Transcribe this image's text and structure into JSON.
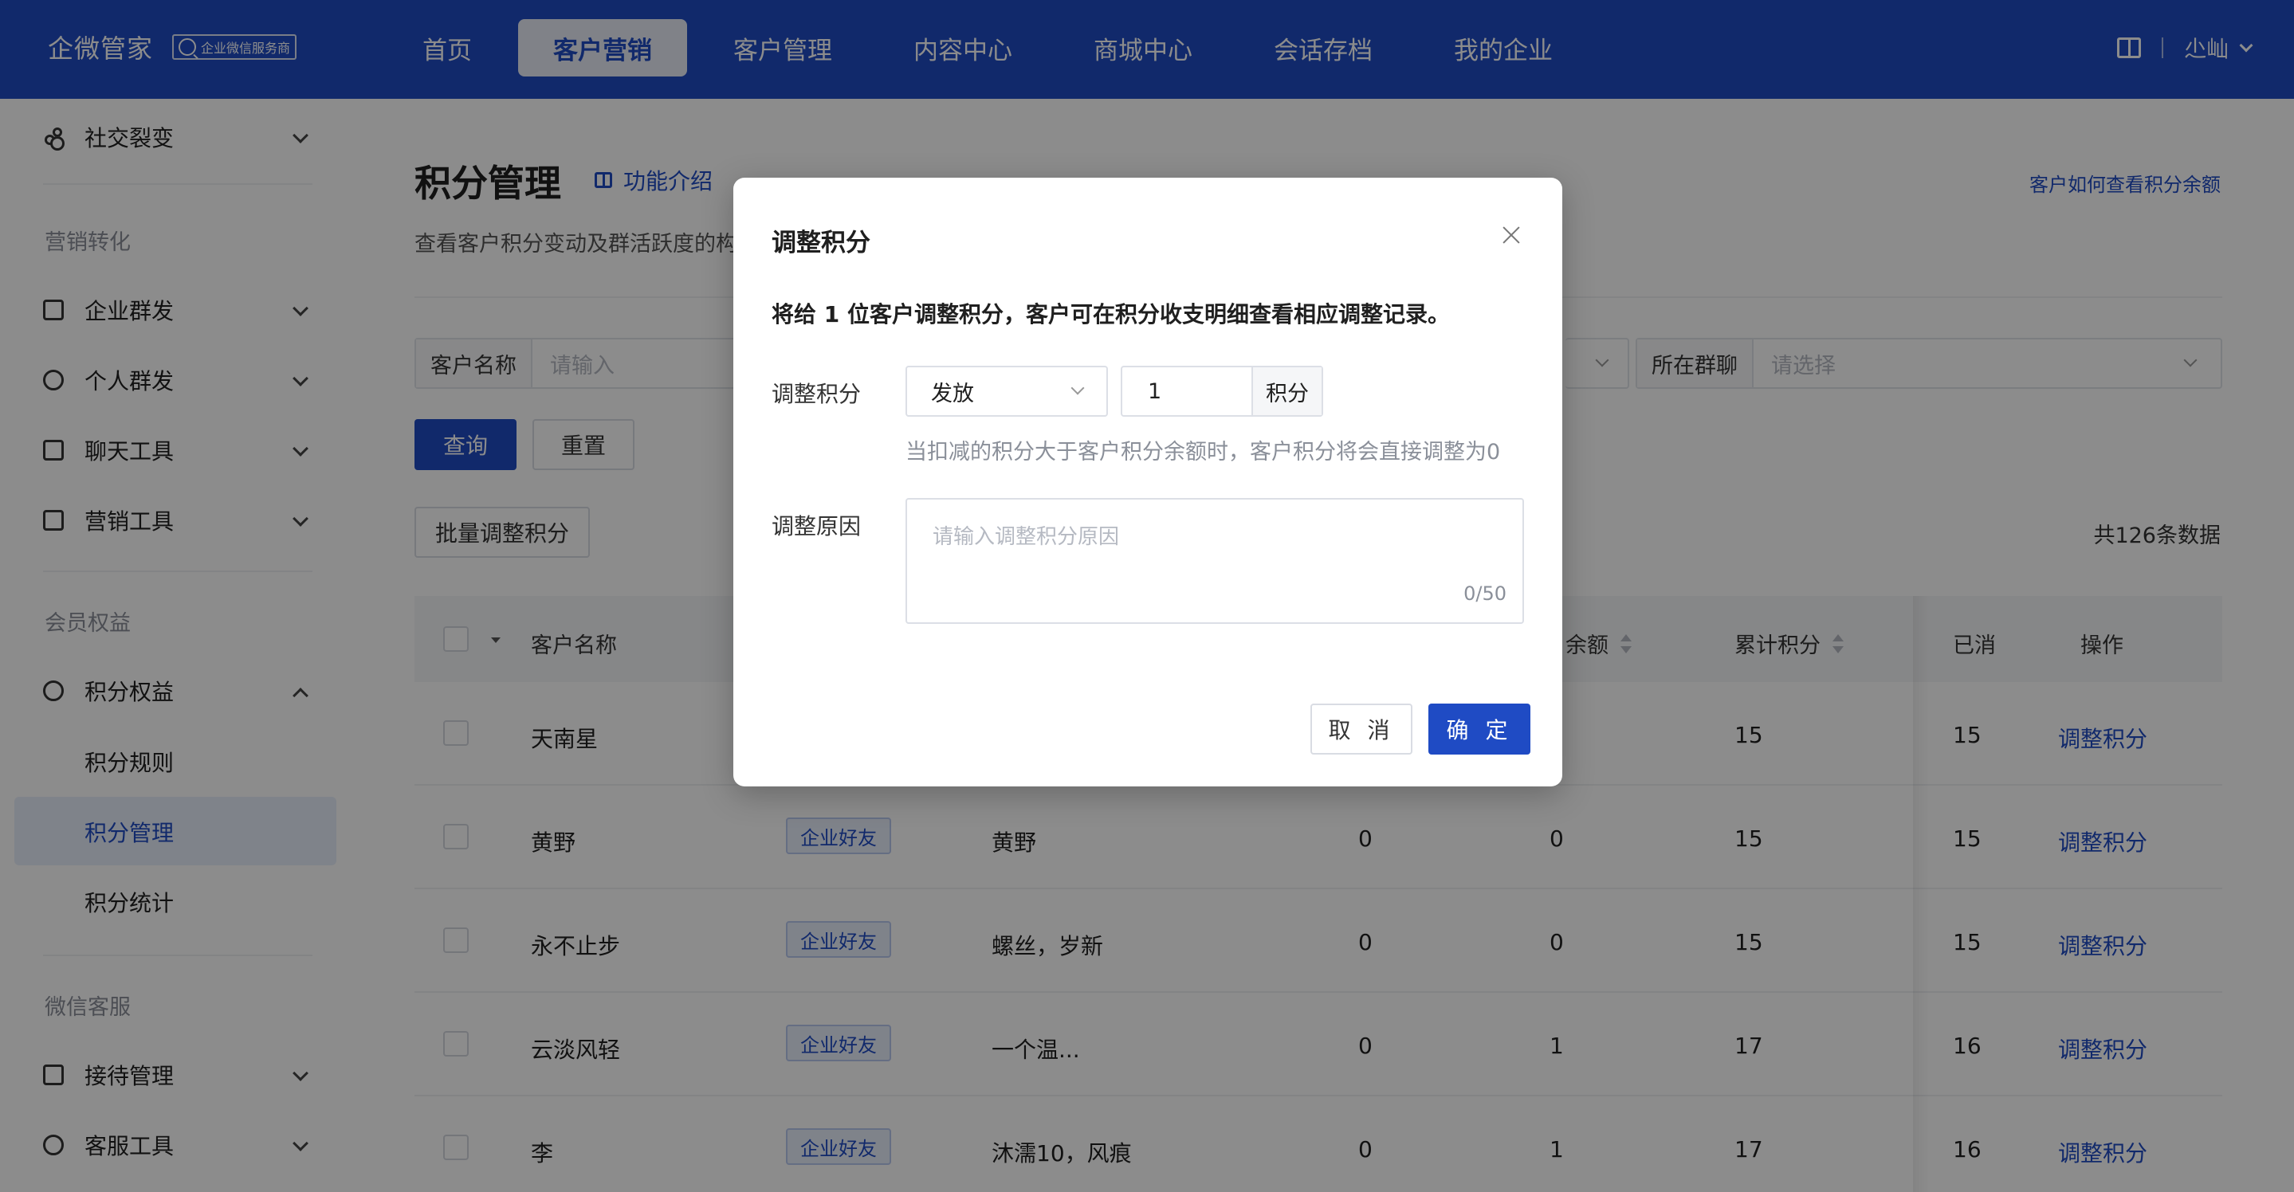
{
  "topbar": {
    "brand": "企微管家",
    "badge": "企业微信服务商",
    "nav": [
      "首页",
      "客户营销",
      "客户管理",
      "内容中心",
      "商城中心",
      "会话存档",
      "我的企业"
    ],
    "active_index": 1,
    "user": "尐屾",
    "accent": "#1f4bc4"
  },
  "sidebar": {
    "top_item": "社交裂变",
    "group1": "营销转化",
    "group1_items": [
      "企业群发",
      "个人群发",
      "聊天工具",
      "营销工具"
    ],
    "group2": "会员权益",
    "group2_item": "积分权益",
    "group2_subs": [
      "积分规则",
      "积分管理",
      "积分统计"
    ],
    "group3": "微信客服",
    "group3_items": [
      "接待管理",
      "客服工具"
    ]
  },
  "page": {
    "title": "积分管理",
    "func_link": "功能介绍",
    "desc": "查看客户积分变动及群活跃度的构",
    "help_link": "客户如何查看积分余额",
    "filter_name_label": "客户名称",
    "filter_name_placeholder": "请输入",
    "filter_group_label": "所在群聊",
    "filter_group_placeholder": "请选择",
    "query_btn": "查询",
    "reset_btn": "重置",
    "batch_btn": "批量调整积分",
    "total": "共126条数据"
  },
  "table": {
    "headers": {
      "name": "客户名称",
      "balance": "余额",
      "total_points": "累计积分",
      "used": "已消",
      "op": "操作"
    },
    "rows": [
      {
        "name": "天南星",
        "tag": "",
        "remark": "",
        "c1": "",
        "c2": "",
        "total": "15",
        "used": "15",
        "op": "调整积分"
      },
      {
        "name": "黄野",
        "tag": "企业好友",
        "remark": "黄野",
        "c1": "0",
        "c2": "0",
        "total": "15",
        "used": "15",
        "op": "调整积分"
      },
      {
        "name": "永不止步",
        "tag": "企业好友",
        "remark": "螺丝，岁新",
        "c1": "0",
        "c2": "0",
        "total": "15",
        "used": "15",
        "op": "调整积分"
      },
      {
        "name": "云淡风轻",
        "tag": "企业好友",
        "remark": "一个温...",
        "c1": "0",
        "c2": "1",
        "total": "17",
        "used": "16",
        "op": "调整积分"
      },
      {
        "name": "李",
        "tag": "企业好友",
        "remark": "沐濡10，风痕",
        "c1": "0",
        "c2": "1",
        "total": "17",
        "used": "16",
        "op": "调整积分"
      }
    ]
  },
  "modal": {
    "title": "调整积分",
    "tip": "将给 1 位客户调整积分，客户可在积分收支明细查看相应调整记录。",
    "adjust_label": "调整积分",
    "type_value": "发放",
    "amount_value": "1",
    "amount_suffix": "积分",
    "hint": "当扣减的积分大于客户积分余额时，客户积分将会直接调整为0",
    "reason_label": "调整原因",
    "reason_placeholder": "请输入调整积分原因",
    "reason_count": "0/50",
    "cancel": "取 消",
    "ok": "确 定"
  }
}
